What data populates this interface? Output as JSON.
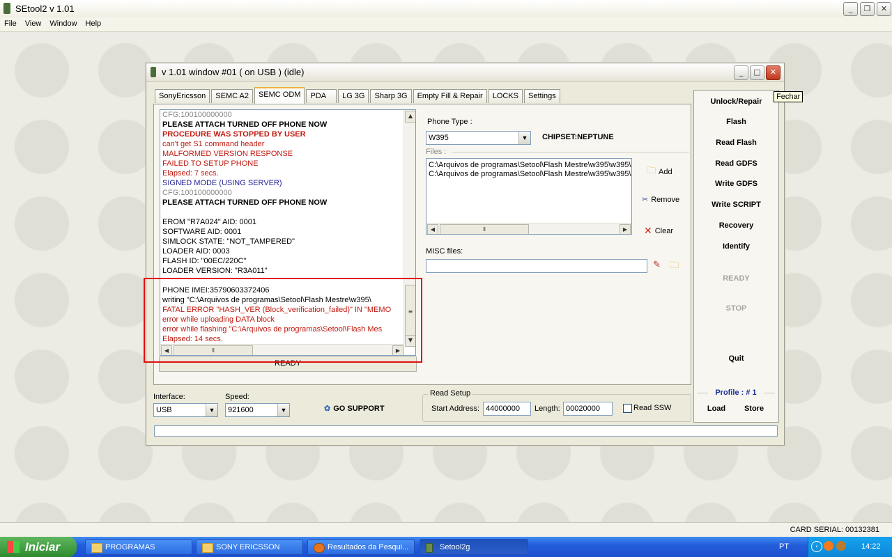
{
  "app": {
    "title": "SEtool2 v 1.01",
    "menu": [
      "File",
      "View",
      "Window",
      "Help"
    ]
  },
  "child": {
    "title": "v 1.01 window #01 ( on USB ) (idle)",
    "tabs": [
      "SonyEricsson",
      "SEMC A2",
      "SEMC ODM",
      "PDA",
      "LG 3G",
      "Sharp 3G",
      "Empty Fill & Repair",
      "LOCKS",
      "Settings"
    ],
    "active_tab": "SEMC ODM",
    "log": [
      {
        "text": "CFG:100100000000",
        "cls": "gray"
      },
      {
        "text": "PLEASE ATTACH TURNED OFF PHONE NOW",
        "cls": "bold"
      },
      {
        "text": "PROCEDURE WAS STOPPED BY USER",
        "cls": "red bold"
      },
      {
        "text": "can't get S1 command header",
        "cls": "red"
      },
      {
        "text": "MALFORMED VERSION RESPONSE",
        "cls": "red"
      },
      {
        "text": "FAILED TO SETUP PHONE",
        "cls": "red"
      },
      {
        "text": "Elapsed: 7 secs.",
        "cls": "red"
      },
      {
        "text": "SIGNED MODE (USING SERVER)",
        "cls": "blue"
      },
      {
        "text": "CFG:100100000000",
        "cls": "gray"
      },
      {
        "text": "PLEASE ATTACH TURNED OFF PHONE NOW",
        "cls": "bold"
      },
      {
        "text": "",
        "cls": ""
      },
      {
        "text": "EROM \"R7A024\" AID: 0001",
        "cls": ""
      },
      {
        "text": "SOFTWARE AID: 0001",
        "cls": ""
      },
      {
        "text": "SIMLOCK STATE: \"NOT_TAMPERED\"",
        "cls": ""
      },
      {
        "text": "LOADER AID: 0003",
        "cls": ""
      },
      {
        "text": "FLASH ID: \"00EC/220C\"",
        "cls": ""
      },
      {
        "text": "LOADER VERSION: \"R3A011\"",
        "cls": ""
      },
      {
        "text": "",
        "cls": ""
      },
      {
        "text": "PHONE IMEI:35790603372406",
        "cls": ""
      },
      {
        "text": "writing \"C:\\Arquivos de programas\\Setool\\Flash Mestre\\w395\\",
        "cls": ""
      },
      {
        "text": "FATAL ERROR \"HASH_VER (Block_verification_failed)\" IN \"MEMO",
        "cls": "red"
      },
      {
        "text": "error while uploading DATA block",
        "cls": "red"
      },
      {
        "text": "error while flashing \"C:\\Arquivos de programas\\Setool\\Flash Mes",
        "cls": "red"
      },
      {
        "text": "Elapsed: 14 secs.",
        "cls": "red"
      }
    ],
    "status": "READY",
    "phone_type_label": "Phone Type :",
    "phone_type": "W395",
    "chipset": "CHIPSET:NEPTUNE",
    "files_label": "Files :",
    "files": [
      "C:\\Arquivos de programas\\Setool\\Flash Mestre\\w395\\w395\\",
      "C:\\Arquivos de programas\\Setool\\Flash Mestre\\w395\\w395\\"
    ],
    "add": "Add",
    "remove": "Remove",
    "clear": "Clear",
    "misc_label": "MISC files:",
    "right_buttons": [
      "Unlock/Repair",
      "Flash",
      "Read Flash",
      "Read GDFS",
      "Write GDFS",
      "Write SCRIPT",
      "Recovery",
      "Identify"
    ],
    "ready_btn": "READY",
    "stop_btn": "STOP",
    "quit_btn": "Quit",
    "profile": "Profile : # 1",
    "load": "Load",
    "store": "Store",
    "interface_label": "Interface:",
    "interface": "USB",
    "speed_label": "Speed:",
    "speed": "921600",
    "go_support": "GO SUPPORT",
    "read_setup": "Read Setup",
    "start_address_label": "Start Address:",
    "start_address": "44000000",
    "length_label": "Length:",
    "length": "00020000",
    "read_ssw": "Read SSW",
    "tooltip": "Fechar"
  },
  "card_serial": "CARD SERIAL: 00132381",
  "taskbar": {
    "start": "Iniciar",
    "tasks": [
      "PROGRAMAS",
      "SONY ERICSSON",
      "Resultados da Pesqui...",
      "Setool2g"
    ],
    "lang": "PT",
    "time": "14:22"
  }
}
